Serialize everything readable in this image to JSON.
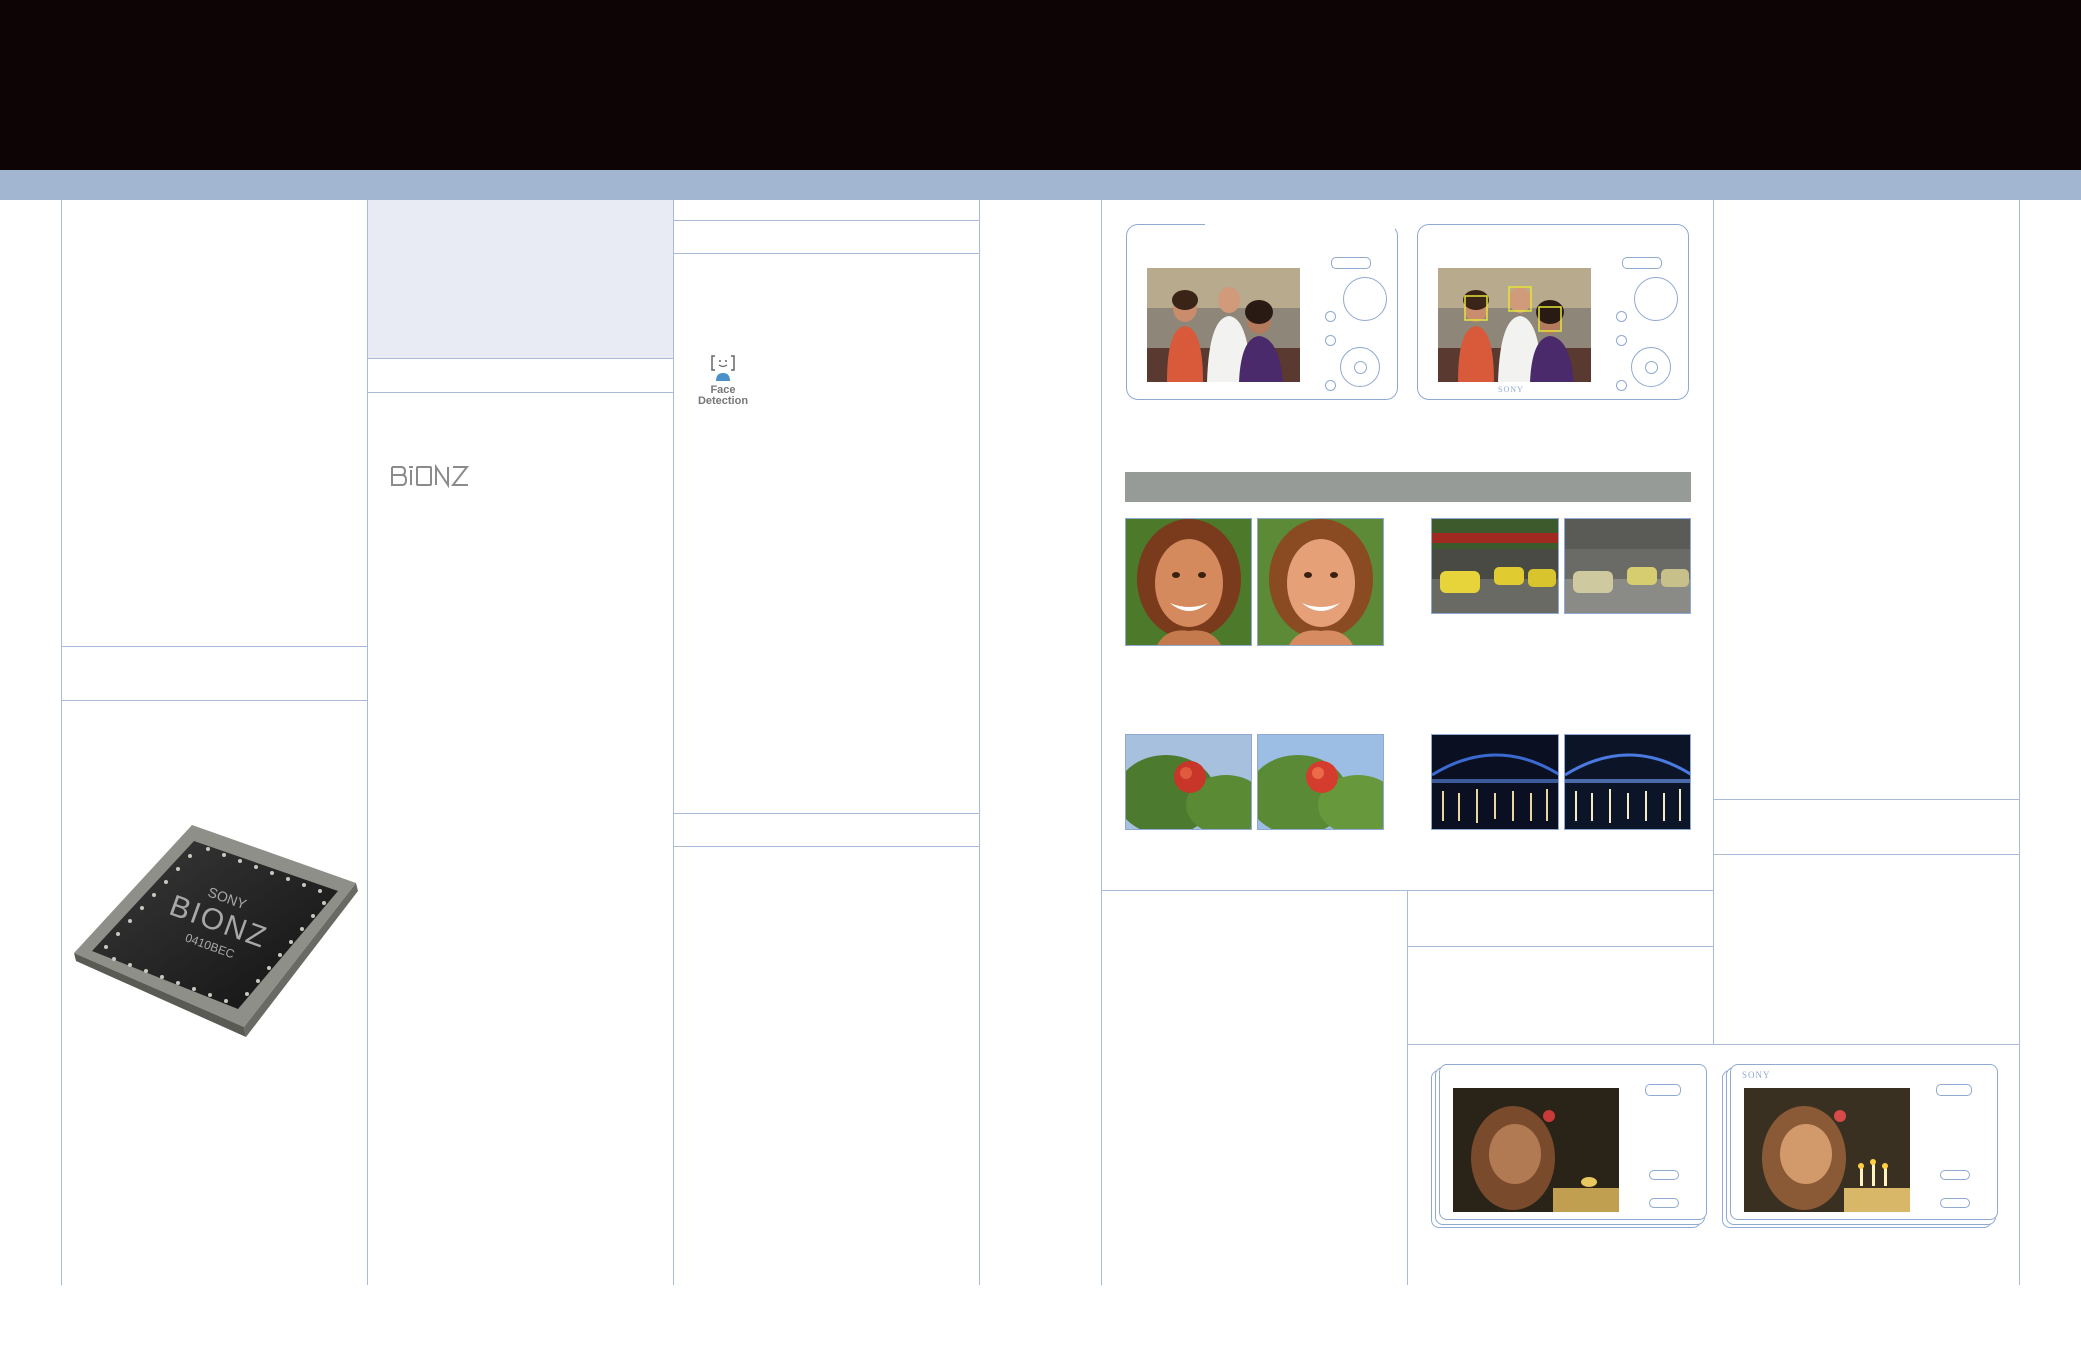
{
  "icons": {
    "face_detection": {
      "name": "face-detection-icon",
      "label": "Face Detection"
    }
  },
  "logos": {
    "bionz": "BIONZ",
    "chip_brand": "SONY",
    "chip_model": "BIONZ",
    "chip_code": "0410BEC",
    "camera_brand": "SONY"
  },
  "colors": {
    "header": "#0d0505",
    "band": "#a2b6d1",
    "rules": "#a9bbd8",
    "shaded_panel": "#e8ebf3",
    "gray_bar": "#969b97"
  }
}
